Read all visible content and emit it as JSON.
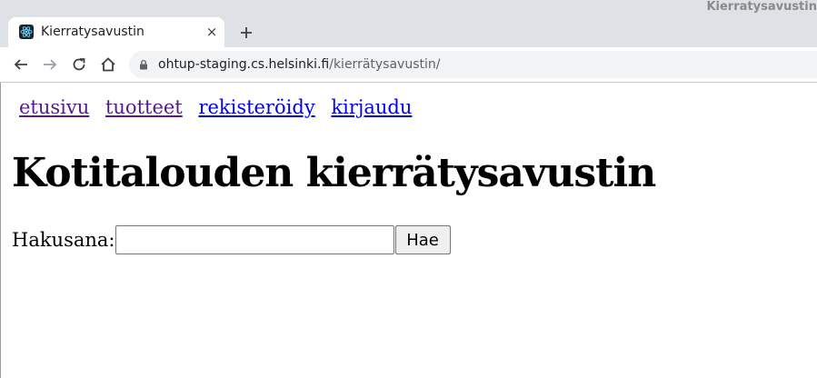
{
  "window": {
    "title": "Kierratysavustin"
  },
  "tab": {
    "title": "Kierratysavustin",
    "favicon": "react-logo-icon",
    "close_symbol": "×",
    "new_tab_symbol": "+"
  },
  "toolbar": {
    "back_icon": "back-arrow-icon",
    "forward_icon": "forward-arrow-icon",
    "reload_icon": "reload-icon",
    "home_icon": "home-icon",
    "url_host": "ohtup-staging.cs.helsinki.fi",
    "url_path": "/kierrätysavustin/"
  },
  "nav": {
    "links": [
      {
        "label": "etusivu",
        "visited": true
      },
      {
        "label": "tuotteet",
        "visited": true
      },
      {
        "label": "rekisteröidy",
        "visited": false
      },
      {
        "label": "kirjaudu",
        "visited": false
      }
    ]
  },
  "main": {
    "heading": "Kotitalouden kierrätysavustin",
    "search": {
      "label": "Hakusana:",
      "value": "",
      "placeholder": "",
      "button_label": "Hae"
    }
  },
  "colors": {
    "chrome_bg": "#dee1e6",
    "visited_link": "#551a8b",
    "unvisited_link": "#0000ee"
  }
}
